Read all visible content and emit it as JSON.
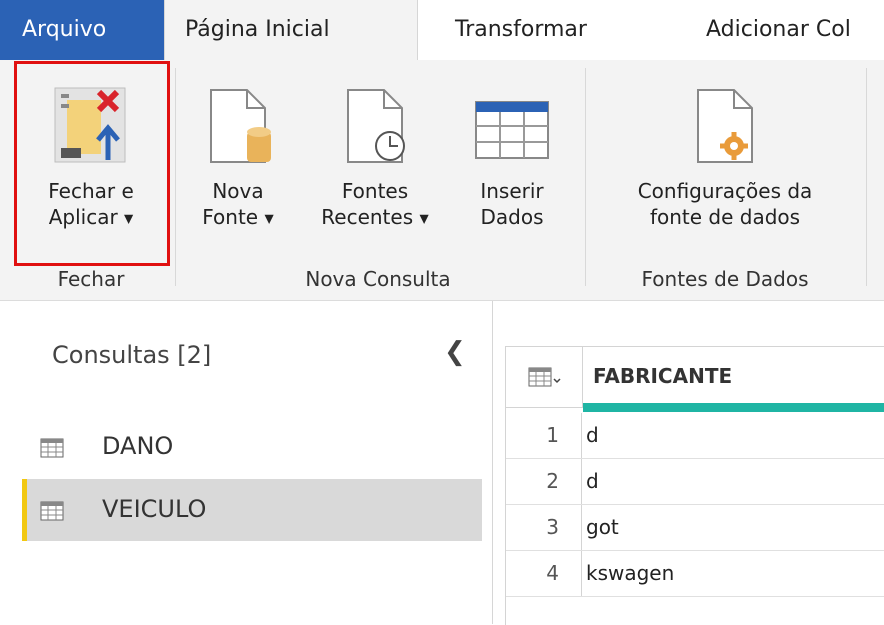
{
  "tabs": {
    "file": "Arquivo",
    "home": "Página Inicial",
    "transform": "Transformar",
    "add_column": "Adicionar Col"
  },
  "ribbon": {
    "close_apply": {
      "line1": "Fechar e",
      "line2": "Aplicar",
      "icon": "close-apply-icon"
    },
    "new_source": {
      "line1": "Nova",
      "line2": "Fonte",
      "icon": "new-source-icon"
    },
    "recent_sources": {
      "line1": "Fontes",
      "line2": "Recentes",
      "icon": "recent-sources-icon"
    },
    "enter_data": {
      "line1": "Inserir",
      "line2": "Dados",
      "icon": "enter-data-icon"
    },
    "data_source_settings": {
      "line1": "Configurações da",
      "line2": "fonte de dados",
      "icon": "data-source-settings-icon"
    },
    "groups": {
      "close": "Fechar",
      "new_query": "Nova Consulta",
      "data_sources": "Fontes de Dados"
    }
  },
  "queries": {
    "title": "Consultas [2]",
    "items": [
      {
        "label": "DANO",
        "selected": false
      },
      {
        "label": "VEICULO",
        "selected": true
      }
    ]
  },
  "grid": {
    "column_header": "FABRICANTE",
    "rows": [
      {
        "n": "1",
        "value": "d"
      },
      {
        "n": "2",
        "value": "d"
      },
      {
        "n": "3",
        "value": "got"
      },
      {
        "n": "4",
        "value": "kswagen"
      }
    ]
  },
  "colors": {
    "file_tab": "#2b62b5",
    "highlight": "#e01010",
    "accent_yellow": "#f2c811",
    "quality_bar": "#1fb5a4"
  }
}
